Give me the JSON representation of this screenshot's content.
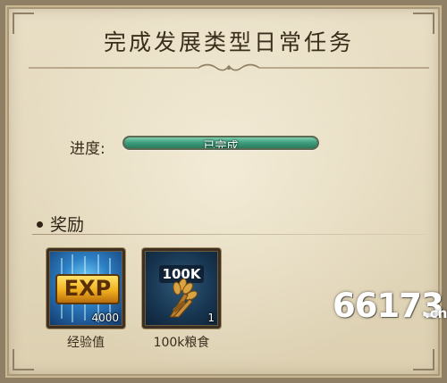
{
  "title": "完成发展类型日常任务",
  "progress": {
    "label": "进度:",
    "status_text": "已完成",
    "fraction": 1.0,
    "fill_color": "#3f9f7f"
  },
  "rewards": {
    "heading": "奖励",
    "items": [
      {
        "icon": "exp-icon",
        "art_text": "EXP",
        "count": "4000",
        "name": "经验值"
      },
      {
        "icon": "grain-icon",
        "art_text": "100K",
        "count": "1",
        "name": "100k粮食"
      }
    ]
  },
  "watermark": {
    "main": "66173",
    "suffix": ".cn"
  }
}
